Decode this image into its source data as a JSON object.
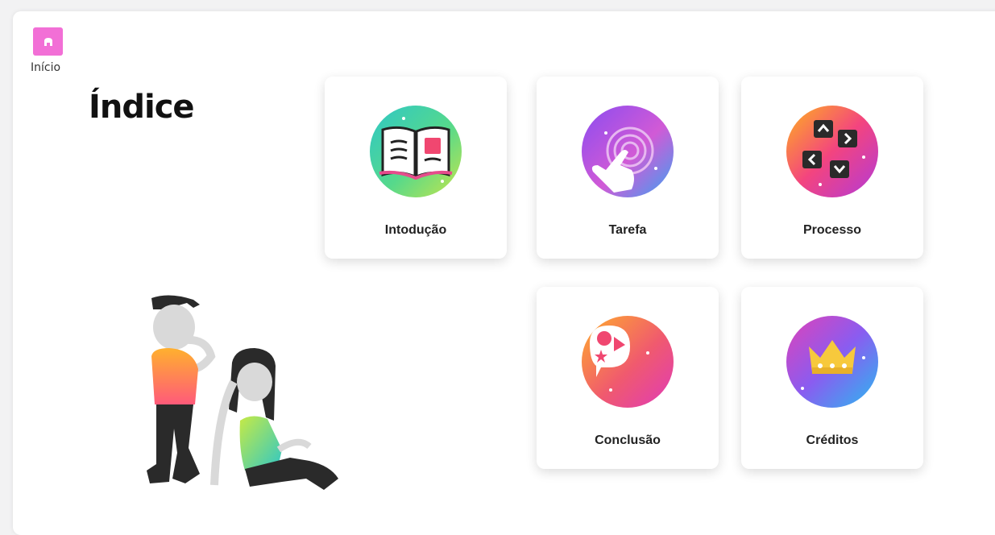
{
  "home": {
    "label": "Início",
    "color": "#f26fd6"
  },
  "page": {
    "title": "Índice"
  },
  "cards": [
    {
      "label": "Intodução",
      "icon": "open-book-icon"
    },
    {
      "label": "Tarefa",
      "icon": "touch-icon"
    },
    {
      "label": "Processo",
      "icon": "arrow-keys-icon"
    },
    {
      "label": "Conclusão",
      "icon": "speech-bubble-shapes-icon"
    },
    {
      "label": "Créditos",
      "icon": "crown-icon"
    }
  ]
}
